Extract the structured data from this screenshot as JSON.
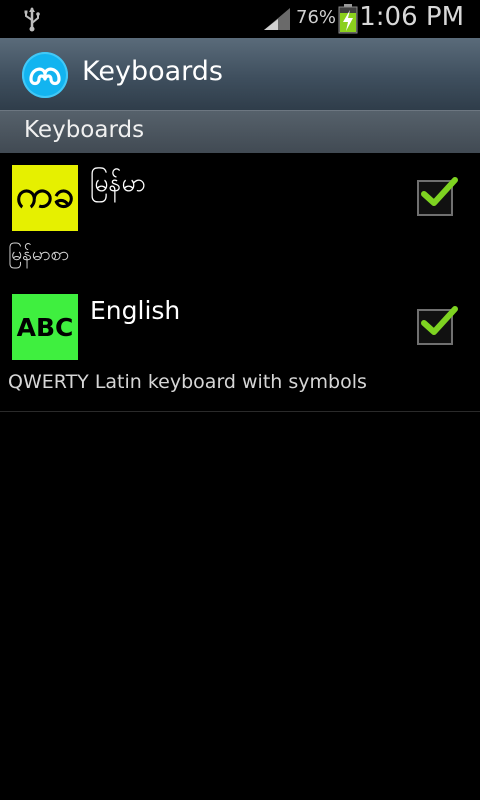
{
  "status_bar": {
    "battery_percent": "76%",
    "time": "1:06 PM",
    "icons": [
      "usb-icon",
      "signal-icon",
      "battery-charging-icon"
    ]
  },
  "title_bar": {
    "title": "Keyboards",
    "icon": "app-logo-icon"
  },
  "section": {
    "title": "Keyboards"
  },
  "keyboards": [
    {
      "icon_text": "ကခ",
      "name": "မြန်မာ",
      "description": "မြန်မာစာ",
      "enabled": true,
      "icon_color": "#e6f000"
    },
    {
      "icon_text": "ABC",
      "name": "English",
      "description": "QWERTY Latin keyboard with symbols",
      "enabled": true,
      "icon_color": "#3fef3f"
    }
  ],
  "colors": {
    "check_accent": "#7ed321",
    "app_icon": "#12b4f0"
  }
}
